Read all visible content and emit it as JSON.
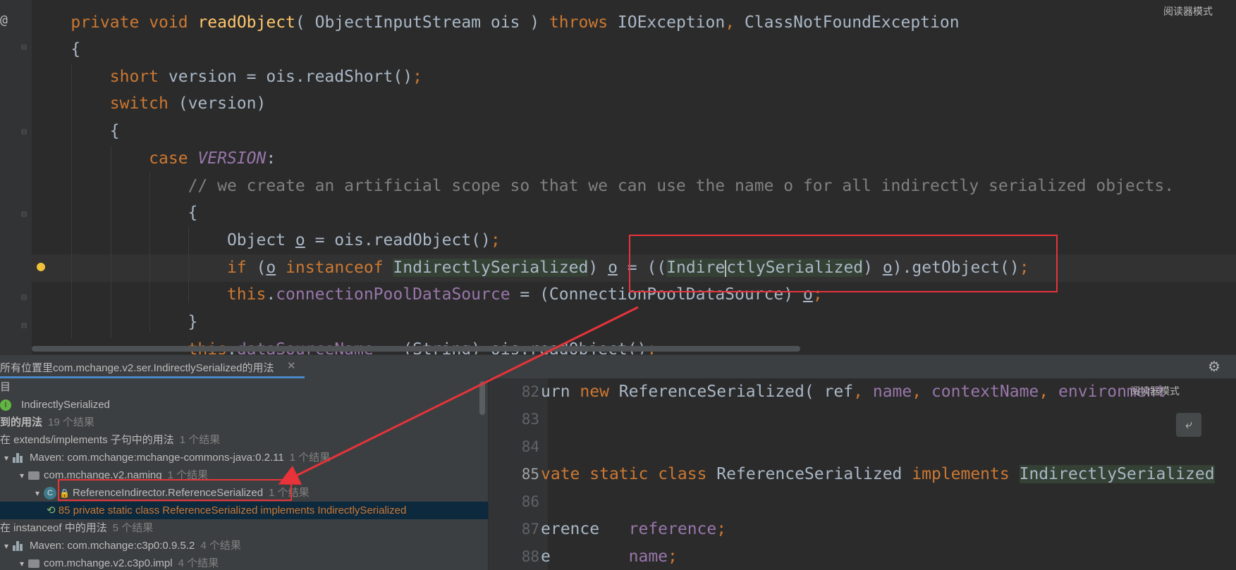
{
  "editor": {
    "reader_mode": "阅读器模式",
    "lines": [
      {
        "tokens": [
          {
            "t": "    ",
            "c": ""
          },
          {
            "t": "private",
            "c": "kw"
          },
          {
            "t": " ",
            "c": ""
          },
          {
            "t": "void",
            "c": "kw"
          },
          {
            "t": " ",
            "c": ""
          },
          {
            "t": "readObject",
            "c": "fn"
          },
          {
            "t": "( ObjectInputStream ois ) ",
            "c": ""
          },
          {
            "t": "throws",
            "c": "kw"
          },
          {
            "t": " IOException",
            "c": ""
          },
          {
            "t": ",",
            "c": "kw"
          },
          {
            "t": " ClassNotFoundException",
            "c": ""
          }
        ]
      },
      {
        "tokens": [
          {
            "t": "    {",
            "c": ""
          }
        ]
      },
      {
        "tokens": [
          {
            "t": "        ",
            "c": ""
          },
          {
            "t": "short",
            "c": "kw"
          },
          {
            "t": " version = ois.readShort()",
            "c": ""
          },
          {
            "t": ";",
            "c": "kw"
          }
        ]
      },
      {
        "tokens": [
          {
            "t": "        ",
            "c": ""
          },
          {
            "t": "switch",
            "c": "kw"
          },
          {
            "t": " (version)",
            "c": ""
          }
        ]
      },
      {
        "tokens": [
          {
            "t": "        {",
            "c": ""
          }
        ]
      },
      {
        "tokens": [
          {
            "t": "            ",
            "c": ""
          },
          {
            "t": "case",
            "c": "kw"
          },
          {
            "t": " ",
            "c": ""
          },
          {
            "t": "VERSION",
            "c": "cst"
          },
          {
            "t": ":",
            "c": ""
          }
        ]
      },
      {
        "tokens": [
          {
            "t": "                ",
            "c": ""
          },
          {
            "t": "// we create an artificial scope so that we can use the name o for all indirectly serialized objects.",
            "c": "cmt"
          }
        ]
      },
      {
        "tokens": [
          {
            "t": "                {",
            "c": ""
          }
        ]
      },
      {
        "tokens": [
          {
            "t": "                    Object ",
            "c": ""
          },
          {
            "t": "o",
            "c": "ul"
          },
          {
            "t": " = ois.readObject()",
            "c": ""
          },
          {
            "t": ";",
            "c": "kw"
          }
        ]
      },
      {
        "tokens": [
          {
            "t": "                    ",
            "c": ""
          },
          {
            "t": "if",
            "c": "kw"
          },
          {
            "t": " (",
            "c": ""
          },
          {
            "t": "o",
            "c": "ul"
          },
          {
            "t": " ",
            "c": ""
          },
          {
            "t": "instanceof",
            "c": "kw"
          },
          {
            "t": " ",
            "c": ""
          },
          {
            "t": "IndirectlySerialized",
            "c": "hl"
          },
          {
            "t": ") ",
            "c": ""
          },
          {
            "t": "o",
            "c": "ul"
          },
          {
            "t": " = ((",
            "c": ""
          },
          {
            "t": "Indire",
            "c": "hl"
          },
          {
            "t": "",
            "c": "caret"
          },
          {
            "t": "ctlySerialized",
            "c": "hl"
          },
          {
            "t": ") ",
            "c": ""
          },
          {
            "t": "o",
            "c": "ul"
          },
          {
            "t": ").getObject()",
            "c": ""
          },
          {
            "t": ";",
            "c": "kw"
          }
        ]
      },
      {
        "tokens": [
          {
            "t": "                    ",
            "c": ""
          },
          {
            "t": "this",
            "c": "kw"
          },
          {
            "t": ".",
            "c": ""
          },
          {
            "t": "connectionPoolDataSource",
            "c": "fld"
          },
          {
            "t": " = (ConnectionPoolDataSource) ",
            "c": ""
          },
          {
            "t": "o",
            "c": "ul"
          },
          {
            "t": ";",
            "c": "kw"
          }
        ]
      },
      {
        "tokens": [
          {
            "t": "                }",
            "c": ""
          }
        ]
      },
      {
        "tokens": [
          {
            "t": "                ",
            "c": ""
          },
          {
            "t": "this",
            "c": "kw"
          },
          {
            "t": ".",
            "c": ""
          },
          {
            "t": "dataSourceName",
            "c": "fld"
          },
          {
            "t": " = (String) ois.readObject()",
            "c": ""
          },
          {
            "t": ";",
            "c": "kw"
          }
        ]
      }
    ]
  },
  "find_panel": {
    "tab_title": "所有位置里com.mchange.v2.ser.IndirectlySerialized的用法",
    "reader_mode": "阅读器模式",
    "rows": [
      {
        "indent": 0,
        "arrow": "",
        "icon": "",
        "label": "目",
        "count": ""
      },
      {
        "indent": 0,
        "arrow": "",
        "icon": "interface",
        "label": "IndirectlySerialized",
        "count": ""
      },
      {
        "indent": 0,
        "arrow": "",
        "icon": "",
        "label": "到的用法",
        "count": "19 个结果",
        "bold": true
      },
      {
        "indent": 0,
        "arrow": "",
        "icon": "",
        "label": "在 extends/implements 子句中的用法",
        "count": "1 个结果"
      },
      {
        "indent": 0,
        "arrow": "⌄",
        "icon": "maven",
        "label": "Maven: com.mchange:mchange-commons-java:0.2.11",
        "count": "1 个结果"
      },
      {
        "indent": 1,
        "arrow": "⌄",
        "icon": "package",
        "label": "com.mchange.v2.naming",
        "count": "1 个结果"
      },
      {
        "indent": 2,
        "arrow": "⌄",
        "icon": "class",
        "label": "ReferenceIndirector.ReferenceSerialized",
        "count": "1 个结果"
      },
      {
        "indent": 3,
        "arrow": "",
        "icon": "usage",
        "label": "85 private static class ReferenceSerialized implements IndirectlySerialized",
        "count": "",
        "selected": true
      },
      {
        "indent": 0,
        "arrow": "",
        "icon": "",
        "label": "在 instanceof 中的用法",
        "count": "5 个结果"
      },
      {
        "indent": 0,
        "arrow": "⌄",
        "icon": "maven",
        "label": "Maven: com.mchange:c3p0:0.9.5.2",
        "count": "4 个结果"
      },
      {
        "indent": 1,
        "arrow": "⌄",
        "icon": "package",
        "label": "com.mchange.v2.c3p0.impl",
        "count": "4 个结果"
      }
    ],
    "preview": [
      {
        "num": "82",
        "tokens": [
          {
            "t": "urn ",
            "c": ""
          },
          {
            "t": "new",
            "c": "kw"
          },
          {
            "t": " ReferenceSerialized( ref",
            "c": ""
          },
          {
            "t": ",",
            "c": "kw"
          },
          {
            "t": " ",
            "c": ""
          },
          {
            "t": "name",
            "c": "fld"
          },
          {
            "t": ",",
            "c": "kw"
          },
          {
            "t": " ",
            "c": ""
          },
          {
            "t": "contextName",
            "c": "fld"
          },
          {
            "t": ",",
            "c": "kw"
          },
          {
            "t": " ",
            "c": ""
          },
          {
            "t": "environment",
            "c": "fld"
          }
        ]
      },
      {
        "num": "83",
        "tokens": []
      },
      {
        "num": "84",
        "tokens": []
      },
      {
        "num": "85",
        "tokens": [
          {
            "t": "vate ",
            "c": "kw"
          },
          {
            "t": "static",
            "c": "kw"
          },
          {
            "t": " ",
            "c": ""
          },
          {
            "t": "class",
            "c": "kw"
          },
          {
            "t": " ReferenceSerialized ",
            "c": ""
          },
          {
            "t": "implements",
            "c": "kw"
          },
          {
            "t": " ",
            "c": ""
          },
          {
            "t": "IndirectlySerialized",
            "c": "hl"
          }
        ]
      },
      {
        "num": "86",
        "tokens": []
      },
      {
        "num": "87",
        "tokens": [
          {
            "t": "erence   ",
            "c": ""
          },
          {
            "t": "reference",
            "c": "fld"
          },
          {
            "t": ";",
            "c": "kw"
          }
        ]
      },
      {
        "num": "88",
        "tokens": [
          {
            "t": "e        ",
            "c": ""
          },
          {
            "t": "name",
            "c": "fld"
          },
          {
            "t": ";",
            "c": "kw"
          }
        ]
      }
    ]
  },
  "colors": {
    "annotation_red": "#e8333a",
    "keyword": "#cc7832",
    "highlight": "#344134",
    "selection": "#0d293e"
  }
}
